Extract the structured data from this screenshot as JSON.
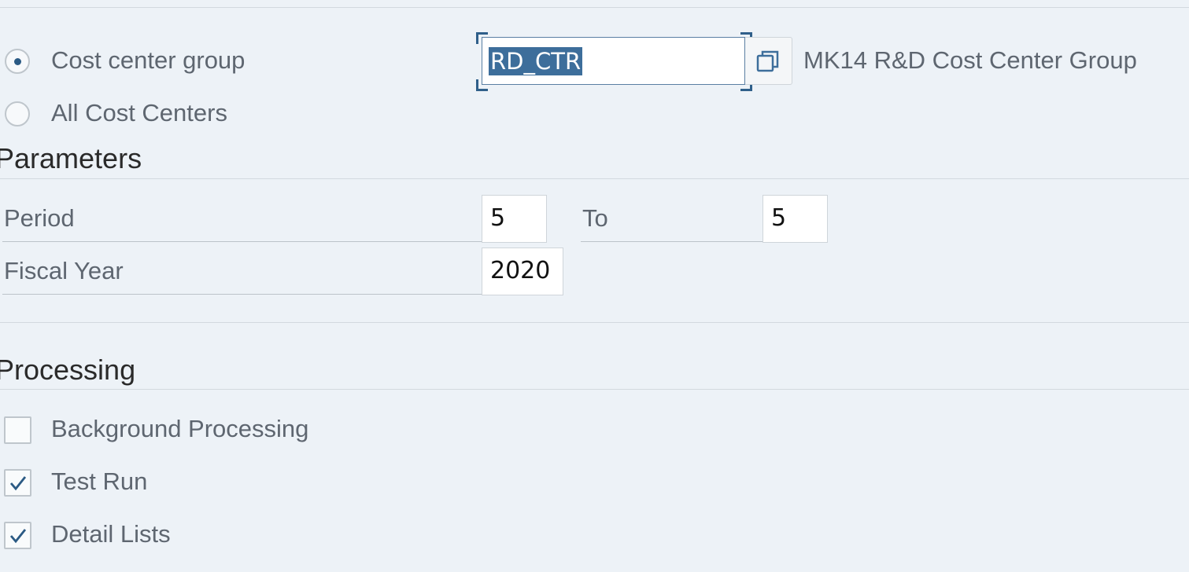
{
  "selection": {
    "cost_center_group": {
      "label": "Cost center group",
      "selected": true,
      "value": "RD_CTR",
      "description": "MK14 R&D Cost Center Group"
    },
    "all_cost_centers": {
      "label": "All Cost Centers",
      "selected": false
    }
  },
  "parameters": {
    "title": "Parameters",
    "period_label": "Period",
    "period_from": "5",
    "to_label": "To",
    "period_to": "5",
    "fiscal_year_label": "Fiscal Year",
    "fiscal_year": "2020"
  },
  "processing": {
    "title": "Processing",
    "background_processing": {
      "label": "Background Processing",
      "checked": false
    },
    "test_run": {
      "label": "Test Run",
      "checked": true
    },
    "detail_lists": {
      "label": "Detail Lists",
      "checked": true
    }
  },
  "colors": {
    "background": "#edf2f7",
    "accent": "#2b5a84",
    "selection_highlight": "#3d6e9b"
  },
  "icons": {
    "value_help": "value-help-icon",
    "checkmark": "checkmark-icon"
  }
}
